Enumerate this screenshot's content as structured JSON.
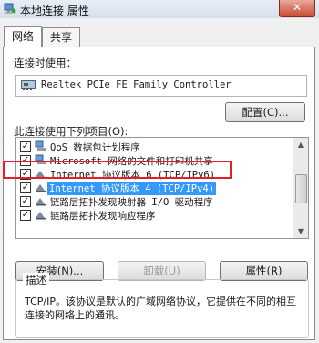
{
  "window": {
    "title": "本地连接 属性",
    "close_label": "✕"
  },
  "tabs": [
    {
      "label": "网络"
    },
    {
      "label": "共享"
    }
  ],
  "connect_using": {
    "label": "连接时使用：",
    "adapter": "Realtek PCIe FE Family Controller"
  },
  "configure_button": "配置(C)...",
  "items_label": "此连接使用下列项目(O):",
  "items": [
    {
      "checked": true,
      "icon": "network-client-icon",
      "label": "QoS 数据包计划程序"
    },
    {
      "checked": true,
      "icon": "network-client-icon",
      "label": "Microsoft 网络的文件和打印机共享"
    },
    {
      "checked": true,
      "icon": "protocol-icon",
      "label": "Internet 协议版本 6 (TCP/IPv6)"
    },
    {
      "checked": true,
      "icon": "protocol-icon",
      "label": "Internet 协议版本 4 (TCP/IPv4)",
      "selected": true
    },
    {
      "checked": true,
      "icon": "protocol-icon",
      "label": "链路层拓扑发现映射器 I/O 驱动程序"
    },
    {
      "checked": true,
      "icon": "protocol-icon",
      "label": "链路层拓扑发现响应程序"
    }
  ],
  "buttons": {
    "install": "安装(N)...",
    "uninstall": "卸载(U)",
    "properties": "属性(R)"
  },
  "description": {
    "title": "描述",
    "text": "TCP/IP。该协议是默认的广域网络协议，它提供在不同的相互连接的网络上的通讯。"
  },
  "colors": {
    "selection": "#3399ff",
    "highlight_box": "#e0202a"
  }
}
